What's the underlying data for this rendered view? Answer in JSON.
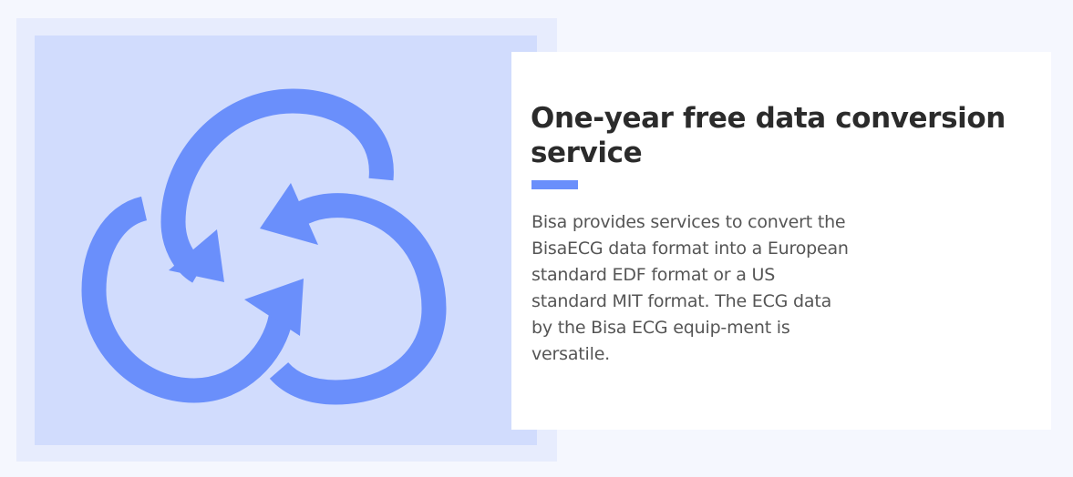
{
  "illustration": {
    "icon": "three-arrow-cycle-icon",
    "accent_color": "#6a8ffb",
    "panel_color": "#d1dcfd",
    "frame_color": "#e7ecfd"
  },
  "card": {
    "title": "One-year free data conversion service",
    "underline_color": "#6a8ffb",
    "body": "Bisa provides services to convert the BisaECG data format into a European standard EDF format or a US standard MIT format. The ECG data by the Bisa ECG equip-ment is versatile."
  }
}
